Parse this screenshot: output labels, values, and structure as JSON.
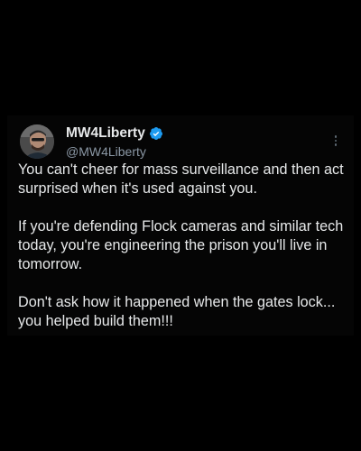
{
  "post": {
    "author": {
      "display_name": "MW4Liberty",
      "handle": "@MW4Liberty",
      "verified": true,
      "verified_color": "#1d9bf0",
      "avatar_icon": "avatar-photo"
    },
    "more_icon": "more-options-icon",
    "paragraphs": [
      "You can't cheer for mass surveillance and then act surprised when it's used against you.",
      "If you're defending Flock cameras and similar tech today, you're engineering the prison you'll live in tomorrow.",
      "Don't ask how it happened when the gates lock... you helped build them!!!"
    ]
  },
  "colors": {
    "page_background": "#000000",
    "card_background": "#050505",
    "text_primary": "#e7e9ea",
    "text_secondary": "#8b98a5"
  }
}
